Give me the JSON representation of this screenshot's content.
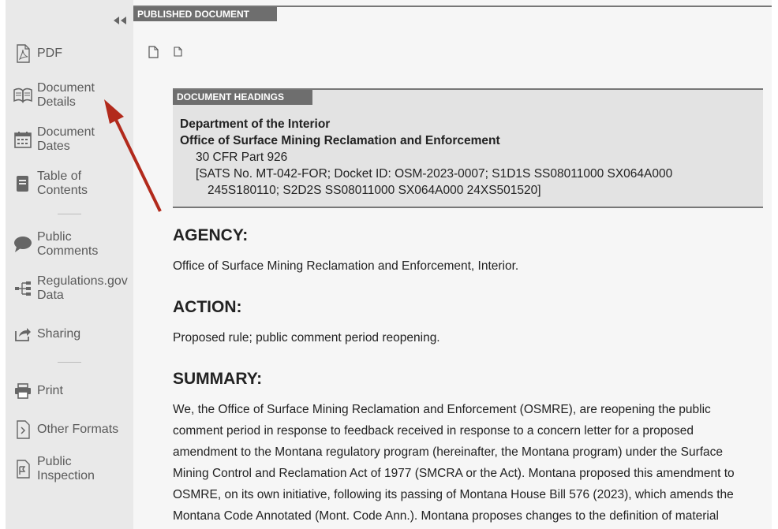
{
  "sidebar": {
    "items": [
      {
        "label": "PDF",
        "icon": "pdf-icon"
      },
      {
        "label": "Document\nDetails",
        "icon": "book-icon"
      },
      {
        "label": "Document\nDates",
        "icon": "calendar-icon"
      },
      {
        "label": "Table of\nContents",
        "icon": "toc-icon"
      },
      {
        "label": "Public\nComments",
        "icon": "comment-icon"
      },
      {
        "label": "Regulations.gov\nData",
        "icon": "tree-icon"
      },
      {
        "label": "Sharing",
        "icon": "share-icon"
      },
      {
        "label": "Print",
        "icon": "print-icon"
      },
      {
        "label": "Other Formats",
        "icon": "code-file-icon"
      },
      {
        "label": "Public\nInspection",
        "icon": "inspection-icon"
      }
    ]
  },
  "main": {
    "published_tag": "PUBLISHED DOCUMENT",
    "headings_tag": "DOCUMENT HEADINGS",
    "headings": {
      "agency": "Department of the Interior",
      "subagency": "Office of Surface Mining Reclamation and Enforcement",
      "cfr": "30 CFR Part 926",
      "docket_line1": "[SATS No. MT-042-FOR; Docket ID: OSM-2023-0007; S1D1S SS08011000 SX064A000",
      "docket_line2": "245S180110; S2D2S SS08011000 SX064A000 24XS501520]"
    },
    "agency_title": "AGENCY:",
    "agency_text": "Office of Surface Mining Reclamation and Enforcement, Interior.",
    "action_title": "ACTION:",
    "action_text": "Proposed rule; public comment period reopening.",
    "summary_title": "SUMMARY:",
    "summary_text": "We, the Office of Surface Mining Reclamation and Enforcement (OSMRE), are reopening the public comment period in response to feedback received in response to a concern letter for a proposed amendment to the Montana regulatory program (hereinafter, the Montana program) under the Surface Mining Control and Reclamation Act of 1977 (SMCRA or the Act). Montana proposed this amendment to OSMRE, on its own initiative, following its passing of Montana House Bill 576 (2023), which amends the Montana Code Annotated (Mont. Code Ann.). Montana proposes changes to the definition of material"
  },
  "colors": {
    "annotation_arrow": "#b22a1c",
    "sidebar_bg": "#e9e9e9",
    "tag_bg": "#6e6e6e"
  }
}
